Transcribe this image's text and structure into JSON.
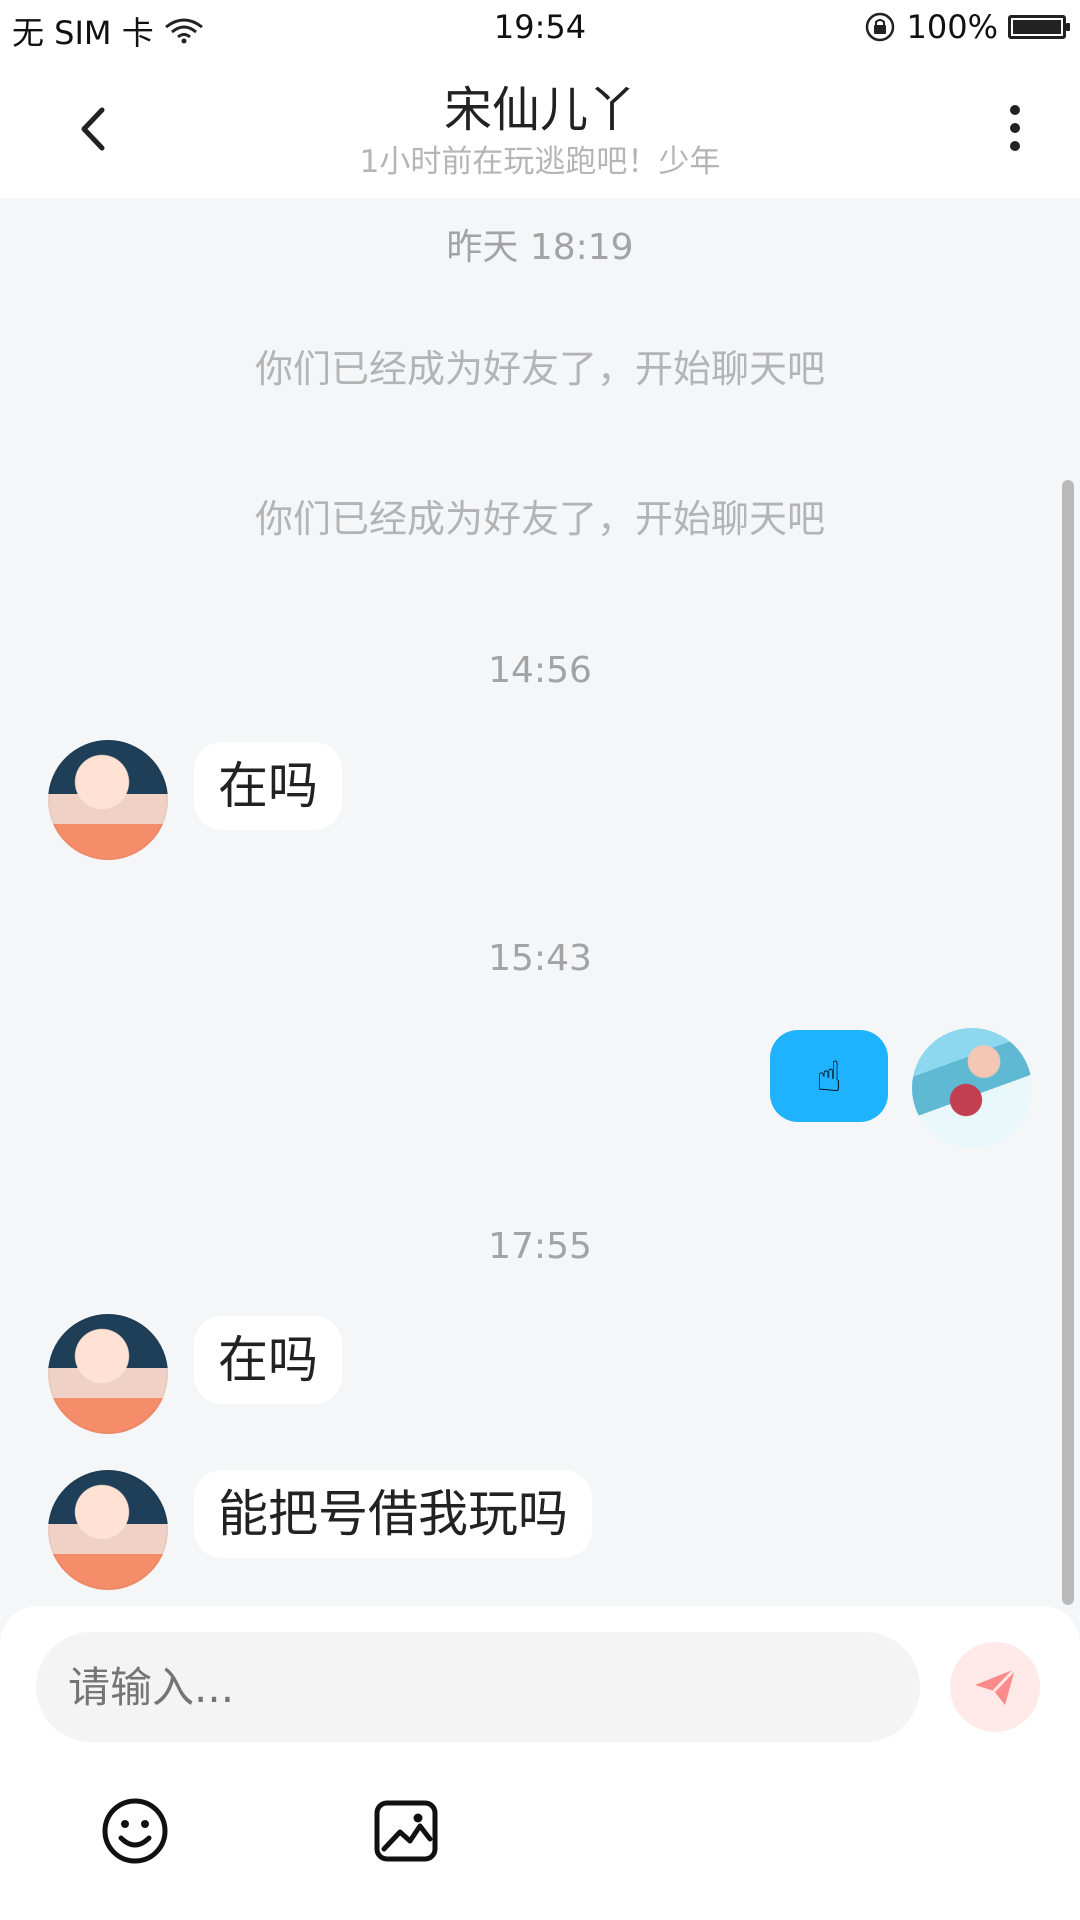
{
  "status_bar": {
    "carrier": "无 SIM 卡",
    "time": "19:54",
    "battery": "100%"
  },
  "header": {
    "title": "宋仙儿丫",
    "subtitle": "1小时前在玩逃跑吧！少年"
  },
  "chat": {
    "timestamps": [
      "昨天 18:19",
      "14:56",
      "15:43",
      "17:55"
    ],
    "system_messages": [
      "你们已经成为好友了，开始聊天吧",
      "你们已经成为好友了，开始聊天吧"
    ],
    "messages": [
      {
        "from": "other",
        "text": "在吗"
      },
      {
        "from": "self",
        "text": "☝"
      },
      {
        "from": "other",
        "text": "在吗"
      },
      {
        "from": "other",
        "text": "能把号借我玩吗"
      }
    ]
  },
  "input": {
    "placeholder": "请输入..."
  },
  "colors": {
    "outgoing_bubble": "#1fb3ff",
    "background": "#f5f6f8",
    "send_button": "#ffe9e9"
  },
  "icons": [
    "wifi-icon",
    "lock-rotation-icon",
    "battery-icon",
    "back-icon",
    "more-vertical-icon",
    "send-icon",
    "emoji-icon",
    "image-icon"
  ]
}
